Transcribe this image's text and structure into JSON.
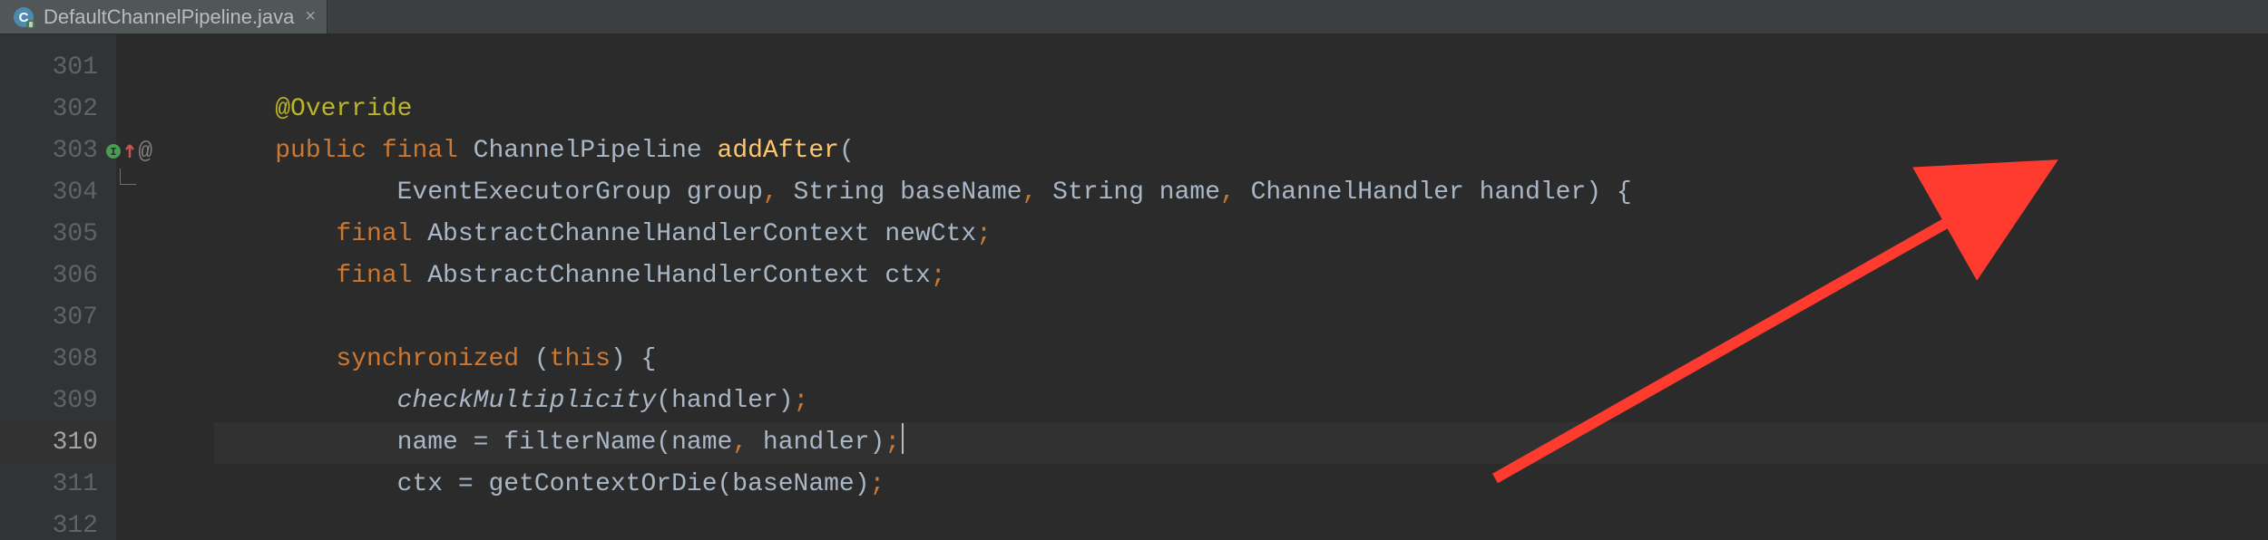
{
  "tab": {
    "filename": "DefaultChannelPipeline.java",
    "close_glyph": "×"
  },
  "gutter": {
    "lines": [
      "301",
      "302",
      "303",
      "304",
      "305",
      "306",
      "307",
      "308",
      "309",
      "310",
      "311",
      "312"
    ],
    "current_index": 9,
    "marker_at_index": 2,
    "marker_glyph": "@"
  },
  "code": {
    "lines": [
      {
        "indent": "    ",
        "tokens": []
      },
      {
        "indent": "    ",
        "tokens": [
          {
            "t": "@Override",
            "c": "an"
          }
        ]
      },
      {
        "indent": "    ",
        "tokens": [
          {
            "t": "public ",
            "c": "k"
          },
          {
            "t": "final ",
            "c": "k"
          },
          {
            "t": "ChannelPipeline ",
            "c": "pl"
          },
          {
            "t": "addAfter",
            "c": "mn"
          },
          {
            "t": "(",
            "c": "pl"
          }
        ]
      },
      {
        "indent": "            ",
        "tokens": [
          {
            "t": "EventExecutorGroup group",
            "c": "pl"
          },
          {
            "t": ", ",
            "c": "sc"
          },
          {
            "t": "String baseName",
            "c": "pl"
          },
          {
            "t": ", ",
            "c": "sc"
          },
          {
            "t": "String name",
            "c": "pl"
          },
          {
            "t": ", ",
            "c": "sc"
          },
          {
            "t": "ChannelHandler handler) {",
            "c": "pl"
          }
        ]
      },
      {
        "indent": "        ",
        "tokens": [
          {
            "t": "final ",
            "c": "k"
          },
          {
            "t": "AbstractChannelHandlerContext newCtx",
            "c": "pl"
          },
          {
            "t": ";",
            "c": "sc"
          }
        ]
      },
      {
        "indent": "        ",
        "tokens": [
          {
            "t": "final ",
            "c": "k"
          },
          {
            "t": "AbstractChannelHandlerContext ctx",
            "c": "pl"
          },
          {
            "t": ";",
            "c": "sc"
          }
        ]
      },
      {
        "indent": "",
        "tokens": []
      },
      {
        "indent": "        ",
        "tokens": [
          {
            "t": "synchronized ",
            "c": "k"
          },
          {
            "t": "(",
            "c": "pl"
          },
          {
            "t": "this",
            "c": "k"
          },
          {
            "t": ") {",
            "c": "pl"
          }
        ]
      },
      {
        "indent": "            ",
        "tokens": [
          {
            "t": "checkMultiplicity",
            "c": "mc"
          },
          {
            "t": "(handler)",
            "c": "pl"
          },
          {
            "t": ";",
            "c": "sc"
          }
        ]
      },
      {
        "indent": "            ",
        "tokens": [
          {
            "t": "name = filterName(name",
            "c": "pl"
          },
          {
            "t": ", ",
            "c": "sc"
          },
          {
            "t": "handler)",
            "c": "pl"
          },
          {
            "t": ";",
            "c": "sc"
          }
        ],
        "caret": true
      },
      {
        "indent": "            ",
        "tokens": [
          {
            "t": "ctx = getContextOrDie(baseName)",
            "c": "pl"
          },
          {
            "t": ";",
            "c": "sc"
          }
        ]
      },
      {
        "indent": "",
        "tokens": []
      }
    ]
  },
  "annotation_arrow": {
    "color": "#ff3b30"
  }
}
